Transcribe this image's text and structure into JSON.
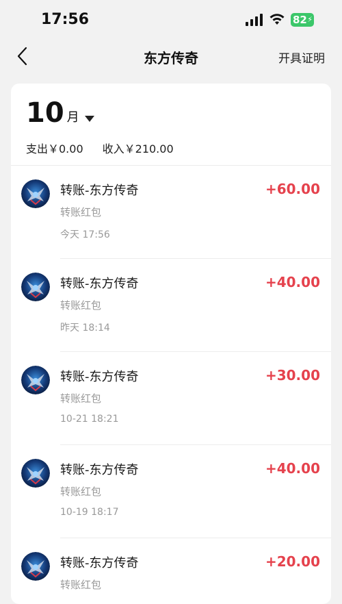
{
  "status_bar": {
    "time": "17:56",
    "battery": "82"
  },
  "nav": {
    "title": "东方传奇",
    "right_action": "开具证明"
  },
  "filter": {
    "month_number": "10",
    "month_unit": "月",
    "expense_text": "支出￥0.00",
    "income_text": "收入￥210.00"
  },
  "transactions": [
    {
      "title": "转账-东方传奇",
      "subtitle": "转账红包",
      "time": "今天 17:56",
      "amount": "+60.00"
    },
    {
      "title": "转账-东方传奇",
      "subtitle": "转账红包",
      "time": "昨天 18:14",
      "amount": "+40.00"
    },
    {
      "title": "转账-东方传奇",
      "subtitle": "转账红包",
      "time": "10-21 18:21",
      "amount": "+30.00"
    },
    {
      "title": "转账-东方传奇",
      "subtitle": "转账红包",
      "time": "10-19 18:17",
      "amount": "+40.00"
    },
    {
      "title": "转账-东方传奇",
      "subtitle": "转账红包",
      "time": "",
      "amount": "+20.00"
    }
  ],
  "colors": {
    "amount": "#e5424d",
    "background": "#f2f2f2",
    "battery": "#3cc76a"
  }
}
